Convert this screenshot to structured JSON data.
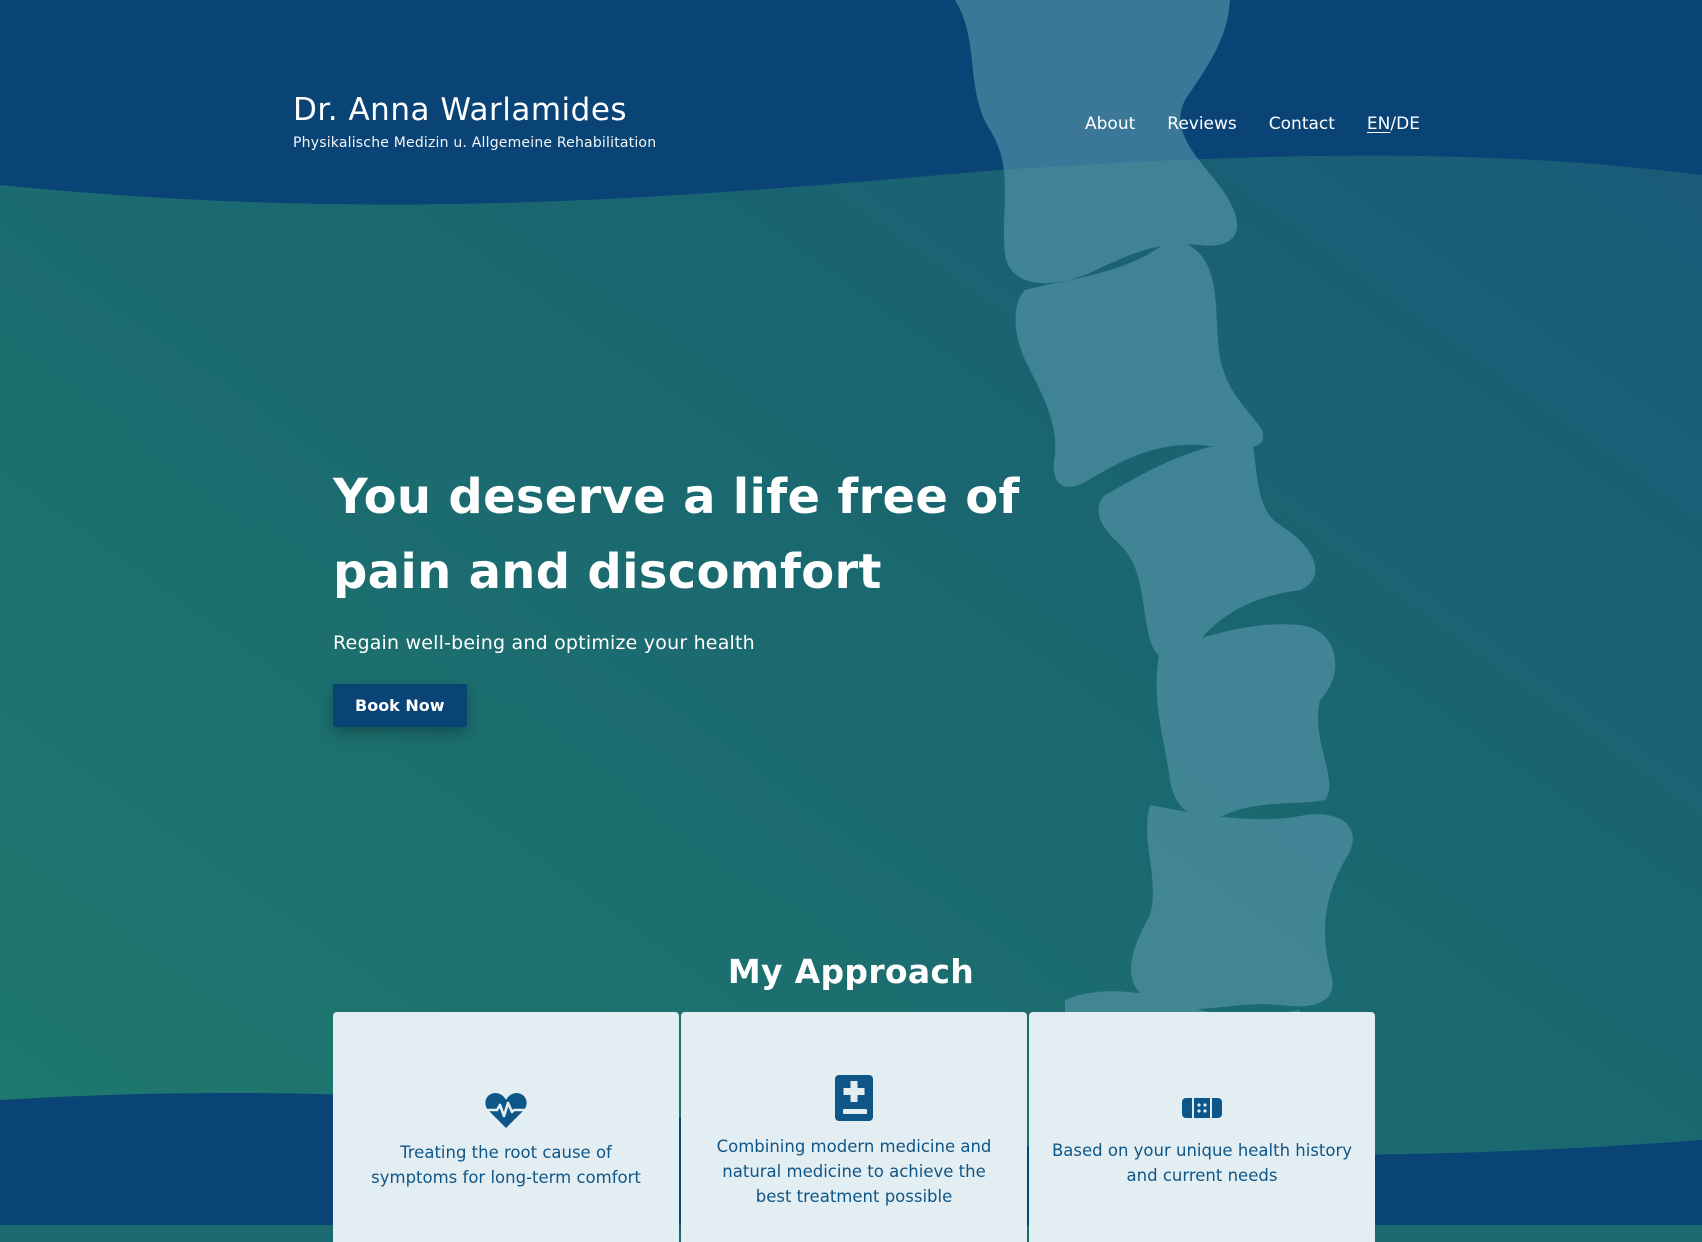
{
  "header": {
    "name": "Dr. Anna Warlamides",
    "subtitle": "Physikalische Medizin u. Allgemeine Rehabilitation"
  },
  "nav": {
    "items": [
      "About",
      "Reviews",
      "Contact"
    ],
    "lang_en": "EN",
    "lang_sep": "/",
    "lang_de": "DE"
  },
  "hero": {
    "heading_line1": "You deserve a life free of",
    "heading_line2": "pain and discomfort",
    "lead": "Regain well-being and optimize your health",
    "cta": "Book Now"
  },
  "approach": {
    "title": "My Approach",
    "cards": [
      {
        "icon": "heartbeat-icon",
        "text": "Treating the root cause of symptoms for long-term comfort"
      },
      {
        "icon": "medical-book-icon",
        "text": "Combining modern medicine and natural medicine to achieve the best treatment possible"
      },
      {
        "icon": "bandage-icon",
        "text": "Based on your unique health history and current needs"
      }
    ]
  },
  "colors": {
    "header_navy": "#0a4476",
    "hero_teal": "#1a6a6f",
    "spine": "#5a97ad",
    "button": "#0a4476",
    "card_bg": "#e3eef2",
    "card_text": "#0f5688"
  }
}
